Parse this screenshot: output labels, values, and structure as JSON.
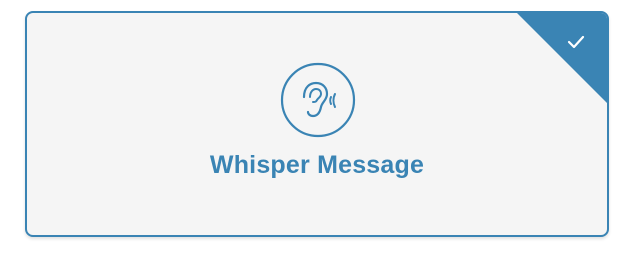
{
  "card": {
    "label": "Whisper Message",
    "icon": "ear-icon",
    "selected": true,
    "selected_icon": "checkmark-icon"
  },
  "colors": {
    "accent": "#3a84b4",
    "card_background": "#f5f5f5",
    "page_background": "#ffffff"
  }
}
